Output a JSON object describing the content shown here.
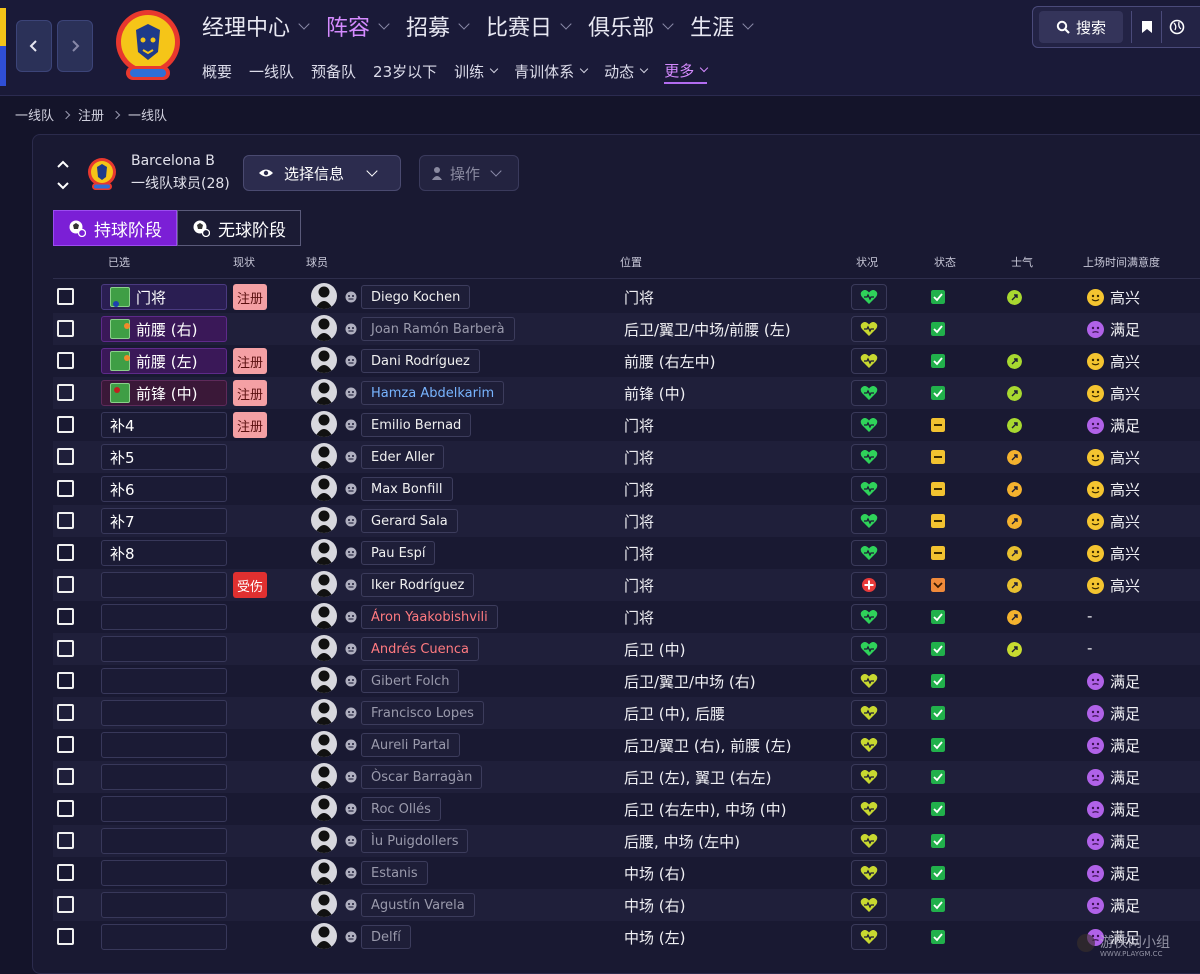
{
  "nav": {
    "main": [
      {
        "label": "经理中心",
        "active": false
      },
      {
        "label": "阵容",
        "active": true
      },
      {
        "label": "招募",
        "active": false
      },
      {
        "label": "比赛日",
        "active": false
      },
      {
        "label": "俱乐部",
        "active": false
      },
      {
        "label": "生涯",
        "active": false
      }
    ],
    "sub": [
      {
        "label": "概要",
        "dropdown": false,
        "active": false
      },
      {
        "label": "一线队",
        "dropdown": false,
        "active": false
      },
      {
        "label": "预备队",
        "dropdown": false,
        "active": false
      },
      {
        "label": "23岁以下",
        "dropdown": false,
        "active": false
      },
      {
        "label": "训练",
        "dropdown": true,
        "active": false
      },
      {
        "label": "青训体系",
        "dropdown": true,
        "active": false
      },
      {
        "label": "动态",
        "dropdown": true,
        "active": false
      },
      {
        "label": "更多",
        "dropdown": true,
        "active": true
      }
    ],
    "search_label": "搜索"
  },
  "breadcrumb": [
    "一线队",
    "注册",
    "一线队"
  ],
  "club": {
    "name": "Barcelona B",
    "squad_label": "一线队球员(28)"
  },
  "toolbar": {
    "select_info": "选择信息",
    "action": "操作"
  },
  "tabs": [
    {
      "label": "持球阶段",
      "active": true
    },
    {
      "label": "无球阶段",
      "active": false
    }
  ],
  "columns": {
    "selected": "已选",
    "status": "现状",
    "player": "球员",
    "position": "位置",
    "condition": "状况",
    "form": "状态",
    "morale": "士气",
    "satisfaction": "上场时间满意度"
  },
  "players": [
    {
      "sel": "门将",
      "pitch": "gk",
      "badge": "注册",
      "badge_type": "reg",
      "name": "Diego Kochen",
      "name_style": "normal",
      "position": "门将",
      "cond": "good",
      "form": "green",
      "morale": "lime",
      "sat": "高兴",
      "sat_face": "happy"
    },
    {
      "sel": "前腰 (右)",
      "pitch": "amr",
      "badge": "",
      "badge_type": "",
      "name": "Joan Ramón Barberà",
      "name_style": "dim",
      "position": "后卫/翼卫/中场/前腰 (左)",
      "cond": "fair",
      "form": "green",
      "morale": "",
      "sat": "满足",
      "sat_face": "ok"
    },
    {
      "sel": "前腰 (左)",
      "pitch": "aml",
      "badge": "注册",
      "badge_type": "reg",
      "name": "Dani Rodríguez",
      "name_style": "normal",
      "position": "前腰 (右左中)",
      "cond": "fair",
      "form": "green",
      "morale": "lime",
      "sat": "高兴",
      "sat_face": "happy"
    },
    {
      "sel": "前锋 (中)",
      "pitch": "st",
      "badge": "注册",
      "badge_type": "reg",
      "name": "Hamza Abdelkarim",
      "name_style": "blue",
      "position": "前锋 (中)",
      "cond": "good",
      "form": "green",
      "morale": "lime",
      "sat": "高兴",
      "sat_face": "happy"
    },
    {
      "sel": "补4",
      "pitch": "",
      "badge": "注册",
      "badge_type": "reg",
      "name": "Emilio Bernad",
      "name_style": "normal",
      "position": "门将",
      "cond": "good",
      "form": "yellow",
      "morale": "lime",
      "sat": "满足",
      "sat_face": "ok"
    },
    {
      "sel": "补5",
      "pitch": "",
      "badge": "",
      "badge_type": "",
      "name": "Eder Aller",
      "name_style": "normal",
      "position": "门将",
      "cond": "good",
      "form": "yellow",
      "morale": "orange",
      "sat": "高兴",
      "sat_face": "happy"
    },
    {
      "sel": "补6",
      "pitch": "",
      "badge": "",
      "badge_type": "",
      "name": "Max Bonfill",
      "name_style": "normal",
      "position": "门将",
      "cond": "good",
      "form": "yellow",
      "morale": "orange",
      "sat": "高兴",
      "sat_face": "happy"
    },
    {
      "sel": "补7",
      "pitch": "",
      "badge": "",
      "badge_type": "",
      "name": "Gerard Sala",
      "name_style": "normal",
      "position": "门将",
      "cond": "good",
      "form": "yellow",
      "morale": "orange",
      "sat": "高兴",
      "sat_face": "happy"
    },
    {
      "sel": "补8",
      "pitch": "",
      "badge": "",
      "badge_type": "",
      "name": "Pau Espí",
      "name_style": "normal",
      "position": "门将",
      "cond": "good",
      "form": "yellow",
      "morale": "gold",
      "sat": "高兴",
      "sat_face": "happy"
    },
    {
      "sel": "",
      "pitch": "",
      "badge": "受伤",
      "badge_type": "inj",
      "name": "Iker Rodríguez",
      "name_style": "normal",
      "position": "门将",
      "cond": "injured",
      "form": "orangedown",
      "morale": "gold",
      "sat": "高兴",
      "sat_face": "happy"
    },
    {
      "sel": "",
      "pitch": "",
      "badge": "",
      "badge_type": "",
      "name": "Áron Yaakobishvili",
      "name_style": "red",
      "position": "门将",
      "cond": "good",
      "form": "green",
      "morale": "orange",
      "sat": "-",
      "sat_face": ""
    },
    {
      "sel": "",
      "pitch": "",
      "badge": "",
      "badge_type": "",
      "name": "Andrés Cuenca",
      "name_style": "red",
      "position": "后卫 (中)",
      "cond": "good",
      "form": "green",
      "morale": "yellowgreen",
      "sat": "-",
      "sat_face": ""
    },
    {
      "sel": "",
      "pitch": "",
      "badge": "",
      "badge_type": "",
      "name": "Gibert Folch",
      "name_style": "dim",
      "position": "后卫/翼卫/中场 (右)",
      "cond": "fair",
      "form": "green",
      "morale": "",
      "sat": "满足",
      "sat_face": "ok"
    },
    {
      "sel": "",
      "pitch": "",
      "badge": "",
      "badge_type": "",
      "name": "Francisco Lopes",
      "name_style": "dim",
      "position": "后卫 (中), 后腰",
      "cond": "fair",
      "form": "green",
      "morale": "",
      "sat": "满足",
      "sat_face": "ok"
    },
    {
      "sel": "",
      "pitch": "",
      "badge": "",
      "badge_type": "",
      "name": "Aureli Partal",
      "name_style": "dim",
      "position": "后卫/翼卫 (右), 前腰 (左)",
      "cond": "fair",
      "form": "green",
      "morale": "",
      "sat": "满足",
      "sat_face": "ok"
    },
    {
      "sel": "",
      "pitch": "",
      "badge": "",
      "badge_type": "",
      "name": "Òscar Barragàn",
      "name_style": "dim",
      "position": "后卫 (左), 翼卫 (右左)",
      "cond": "fair",
      "form": "green",
      "morale": "",
      "sat": "满足",
      "sat_face": "ok"
    },
    {
      "sel": "",
      "pitch": "",
      "badge": "",
      "badge_type": "",
      "name": "Roc Ollés",
      "name_style": "dim",
      "position": "后卫 (右左中), 中场 (中)",
      "cond": "fair",
      "form": "green",
      "morale": "",
      "sat": "满足",
      "sat_face": "ok"
    },
    {
      "sel": "",
      "pitch": "",
      "badge": "",
      "badge_type": "",
      "name": "Ìu Puigdollers",
      "name_style": "dim",
      "position": "后腰, 中场 (左中)",
      "cond": "fair",
      "form": "green",
      "morale": "",
      "sat": "满足",
      "sat_face": "ok"
    },
    {
      "sel": "",
      "pitch": "",
      "badge": "",
      "badge_type": "",
      "name": "Estanis",
      "name_style": "dim",
      "position": "中场 (右)",
      "cond": "fair",
      "form": "green",
      "morale": "",
      "sat": "满足",
      "sat_face": "ok"
    },
    {
      "sel": "",
      "pitch": "",
      "badge": "",
      "badge_type": "",
      "name": "Agustín Varela",
      "name_style": "dim",
      "position": "中场 (右)",
      "cond": "fair",
      "form": "green",
      "morale": "",
      "sat": "满足",
      "sat_face": "ok"
    },
    {
      "sel": "",
      "pitch": "",
      "badge": "",
      "badge_type": "",
      "name": "Delfí",
      "name_style": "dim",
      "position": "中场 (左)",
      "cond": "fair",
      "form": "green",
      "morale": "",
      "sat": "满足",
      "sat_face": "ok"
    }
  ],
  "colors": {
    "accent": "#b26cf0",
    "form_green": "#21b04b",
    "form_yellow": "#f2c230",
    "cond_good": "#2fd35a",
    "cond_fair": "#c8d830",
    "injured": "#e83a3a"
  },
  "watermark": "游侠网小组 WWW.PLAYGM.CC"
}
